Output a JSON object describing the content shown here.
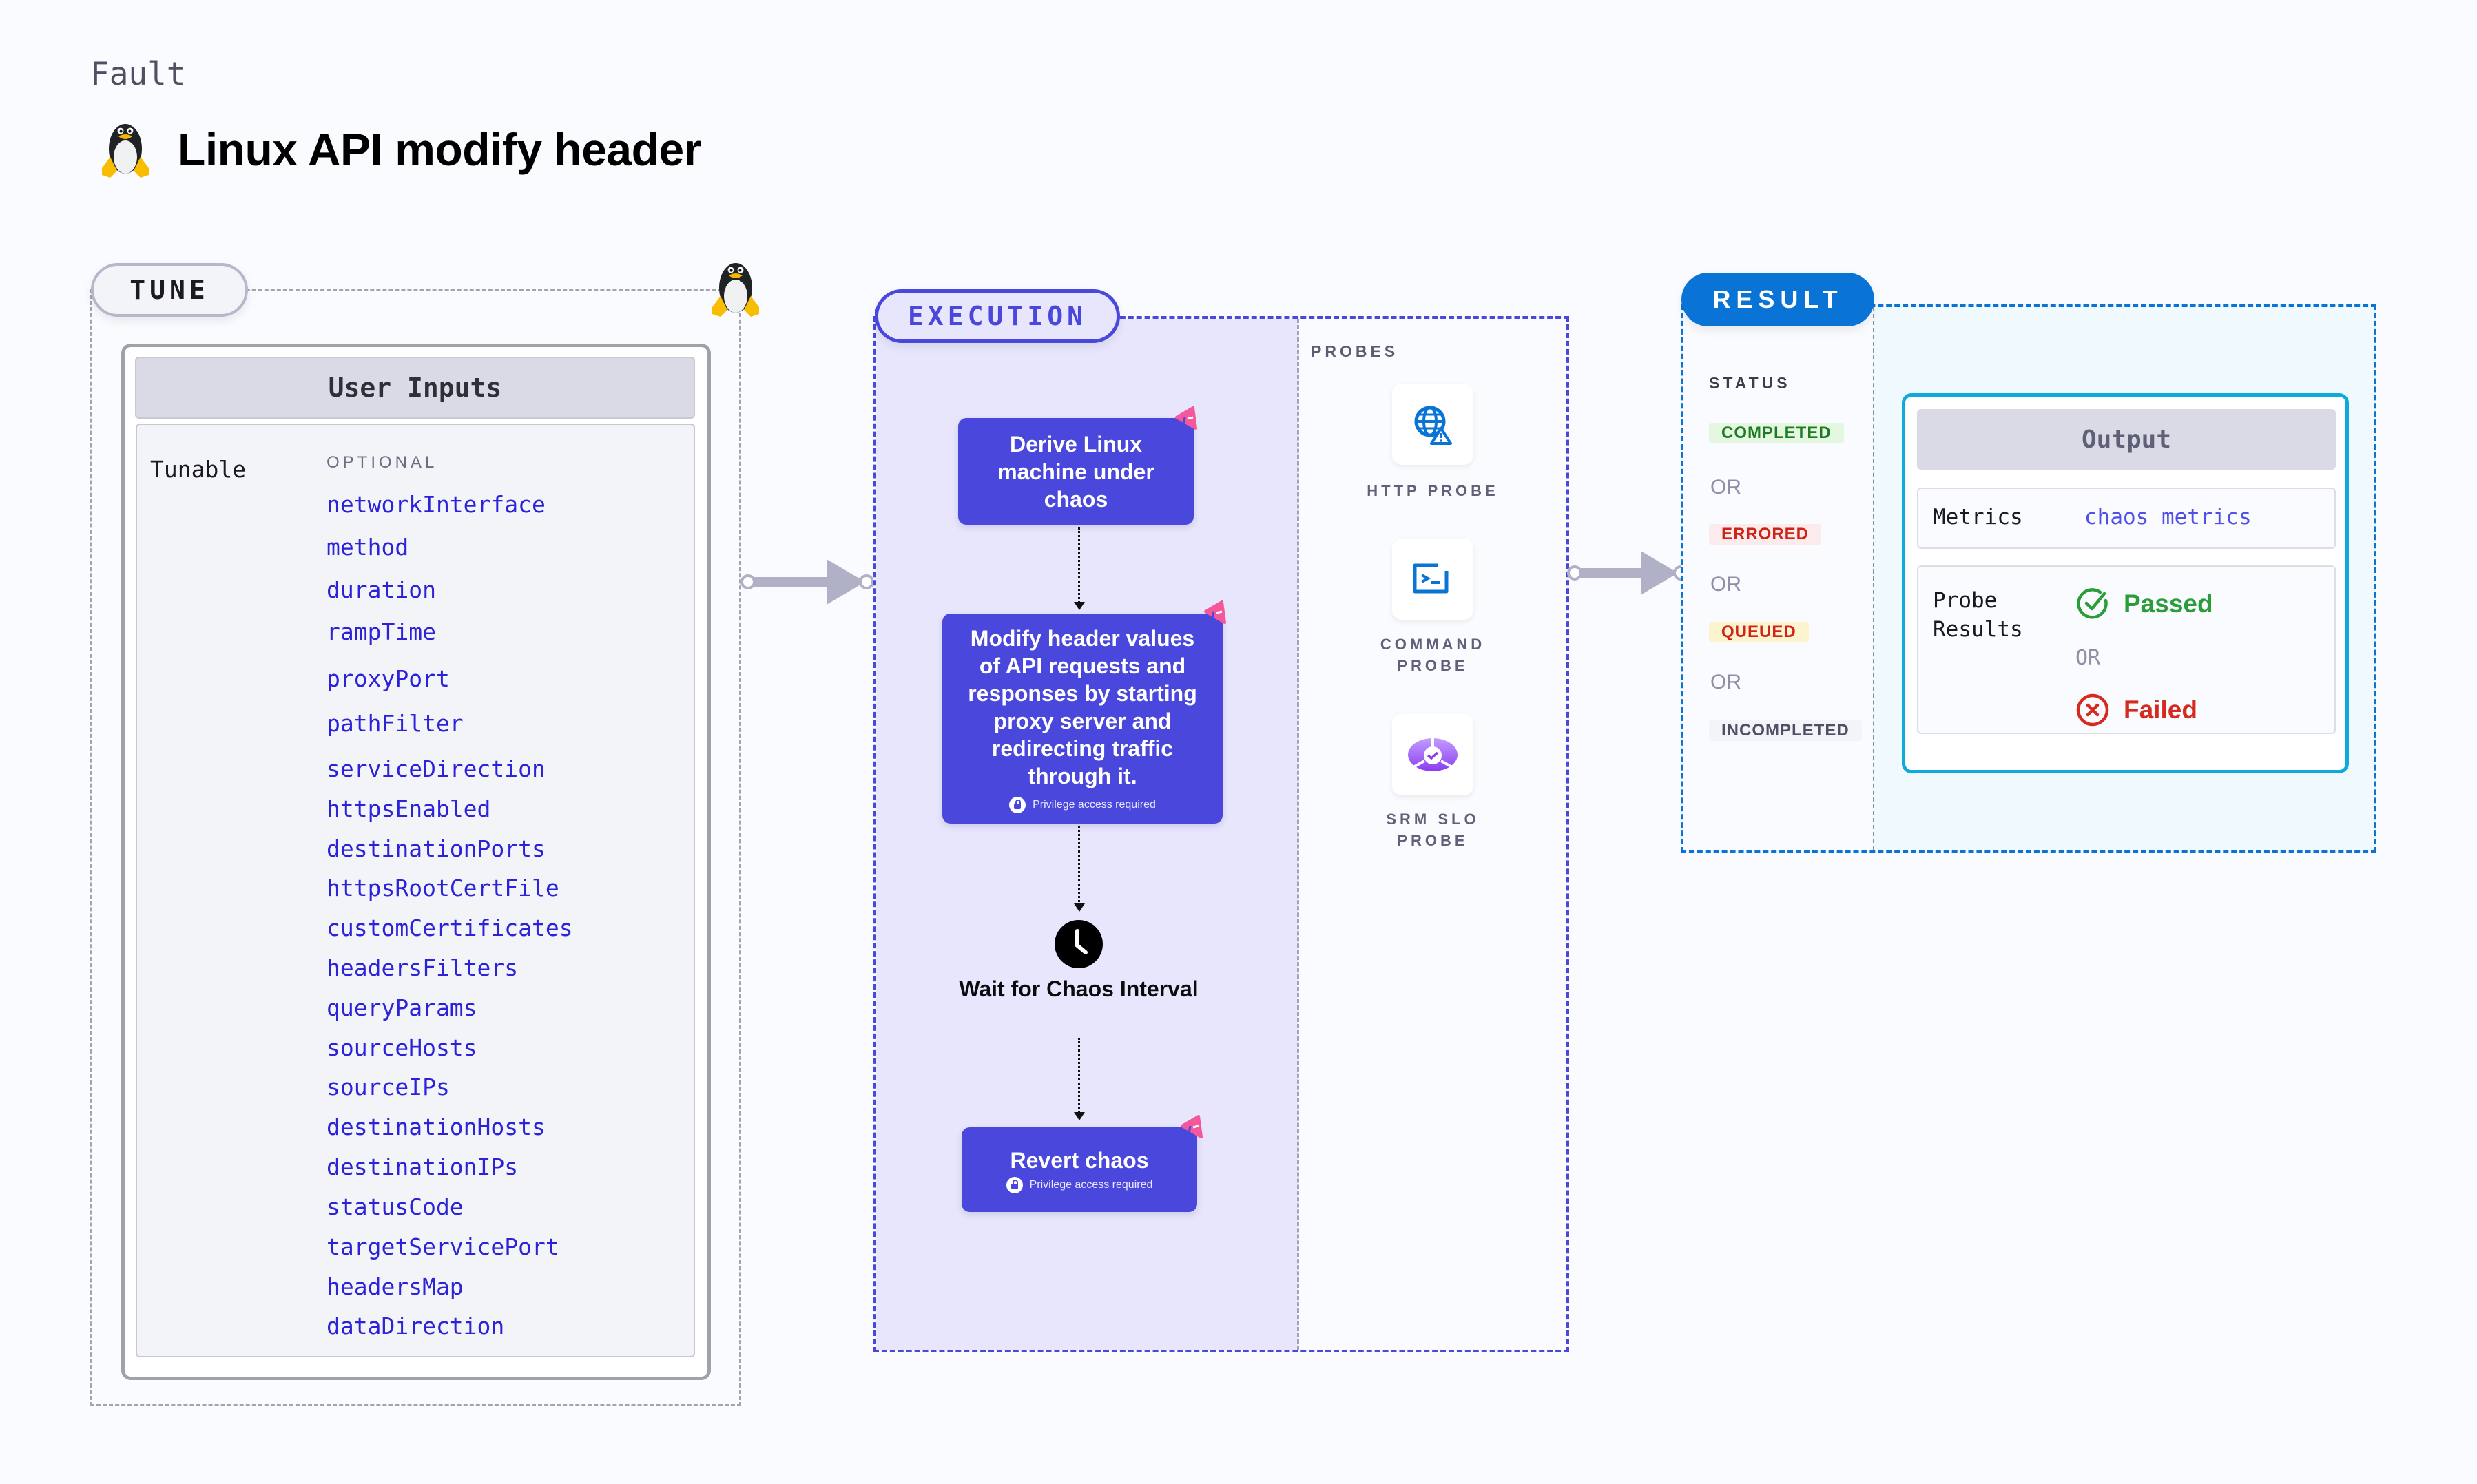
{
  "header": {
    "category": "Fault",
    "title": "Linux API modify header",
    "title_icon": "linux-penguin-icon"
  },
  "tune": {
    "pill_label": "TUNE",
    "platform_icon": "linux-penguin-icon",
    "user_inputs_title": "User Inputs",
    "tunable_label": "Tunable",
    "optional_label": "OPTIONAL",
    "params": [
      "networkInterface",
      "method",
      "duration",
      "rampTime",
      "proxyPort",
      "pathFilter",
      "serviceDirection",
      "httpsEnabled",
      "destinationPorts",
      "httpsRootCertFile",
      "customCertificates",
      "headersFilters",
      "queryParams",
      "sourceHosts",
      "sourceIPs",
      "destinationHosts",
      "destinationIPs",
      "statusCode",
      "targetServicePort",
      "headersMap",
      "dataDirection"
    ]
  },
  "execution": {
    "pill_label": "EXECUTION",
    "steps": [
      {
        "title": "Derive Linux machine under chaos",
        "privilege": ""
      },
      {
        "title": "Modify header values of API requests and responses by starting proxy server and redirecting traffic through it.",
        "privilege": "Privilege access required"
      },
      {
        "title": "Revert chaos",
        "privilege": "Privilege access required"
      }
    ],
    "wait_step": {
      "title": "Wait for Chaos Interval",
      "icon": "clock-icon"
    },
    "probes_label": "PROBES",
    "probes": [
      {
        "label": "HTTP PROBE",
        "icon": "globe-warning-icon"
      },
      {
        "label": "COMMAND PROBE",
        "icon": "terminal-icon"
      },
      {
        "label": "SRM SLO PROBE",
        "icon": "slo-gauge-icon"
      }
    ]
  },
  "result": {
    "pill_label": "RESULT",
    "status_label": "STATUS",
    "or_label": "OR",
    "statuses": [
      {
        "label": "COMPLETED",
        "bg": "#e4f7e1",
        "fg": "#1e7b24"
      },
      {
        "label": "ERRORED",
        "bg": "#fcebec",
        "fg": "#cf2318"
      },
      {
        "label": "QUEUED",
        "bg": "#fcf4cf",
        "fg": "#cf2318"
      },
      {
        "label": "INCOMPLETED",
        "bg": "#f3f3fa",
        "fg": "#4f5162"
      }
    ],
    "output": {
      "title": "Output",
      "metrics_label": "Metrics",
      "metrics_value": "chaos metrics",
      "probe_results_label": "Probe Results",
      "passed_label": "Passed",
      "failed_label": "Failed",
      "or_label": "OR"
    }
  },
  "colors": {
    "execution_accent": "#4a47dc",
    "result_accent": "#0a74d6",
    "param_text": "#2b22d9",
    "passed": "#2a9d3a",
    "failed": "#d42a20"
  }
}
